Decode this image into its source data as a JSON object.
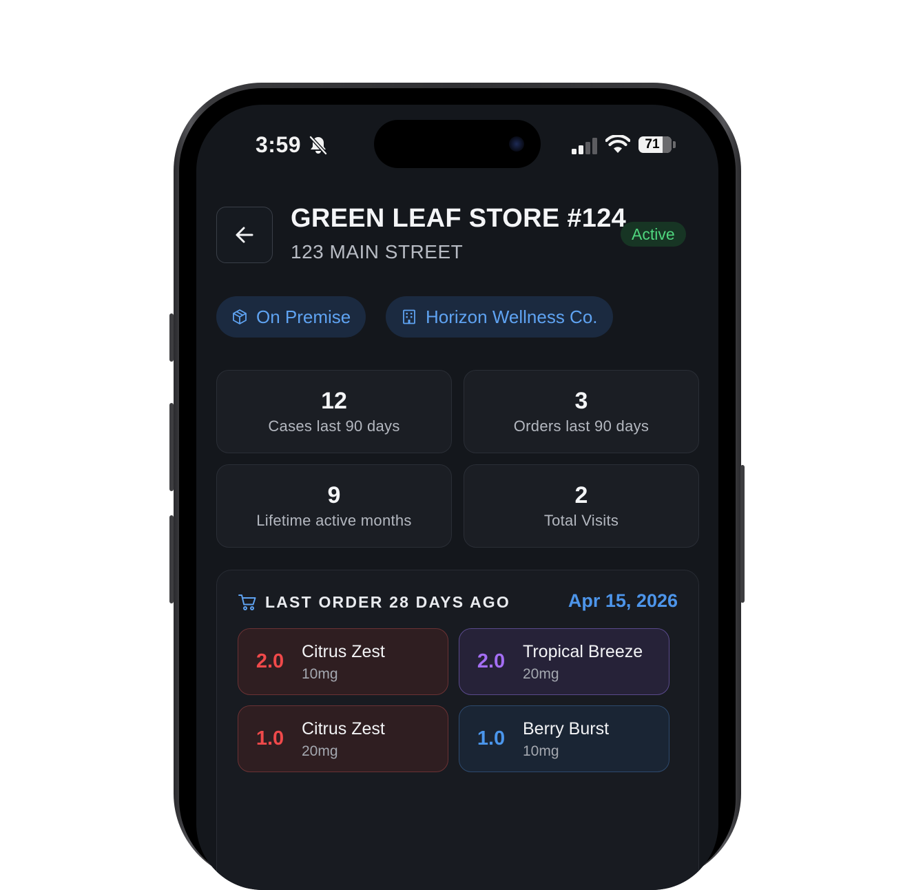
{
  "status_bar": {
    "time": "3:59",
    "battery_level": "71",
    "icons": [
      "bell-slash-icon",
      "cellular-signal-icon",
      "wifi-icon",
      "battery-icon"
    ]
  },
  "header": {
    "back_icon": "arrow-left-icon",
    "store_name": "GREEN LEAF STORE #124",
    "address": "123 MAIN STREET",
    "status": "Active"
  },
  "chips": [
    {
      "label": "On Premise",
      "icon": "box-icon"
    },
    {
      "label": "Horizon Wellness Co.",
      "icon": "building-icon"
    }
  ],
  "stats": [
    {
      "value": "12",
      "label": "Cases last 90 days"
    },
    {
      "value": "3",
      "label": "Orders last 90 days"
    },
    {
      "value": "9",
      "label": "Lifetime active months"
    },
    {
      "value": "2",
      "label": "Total Visits"
    }
  ],
  "last_order": {
    "icon": "shopping-cart-icon",
    "title": "LAST ORDER 28 DAYS AGO",
    "date": "Apr 15, 2026",
    "items": [
      {
        "qty": "2.0",
        "name": "Citrus Zest",
        "dose": "10mg",
        "color": "#f0494a"
      },
      {
        "qty": "2.0",
        "name": "Tropical Breeze",
        "dose": "20mg",
        "color": "#a46ef3"
      },
      {
        "qty": "1.0",
        "name": "Citrus Zest",
        "dose": "20mg",
        "color": "#f0494a"
      },
      {
        "qty": "1.0",
        "name": "Berry Burst",
        "dose": "10mg",
        "color": "#4b96ec"
      }
    ]
  },
  "colors": {
    "screen_bg": "#14171c",
    "accent_blue": "#5fa3f2",
    "active_green": "#4fd67e"
  }
}
